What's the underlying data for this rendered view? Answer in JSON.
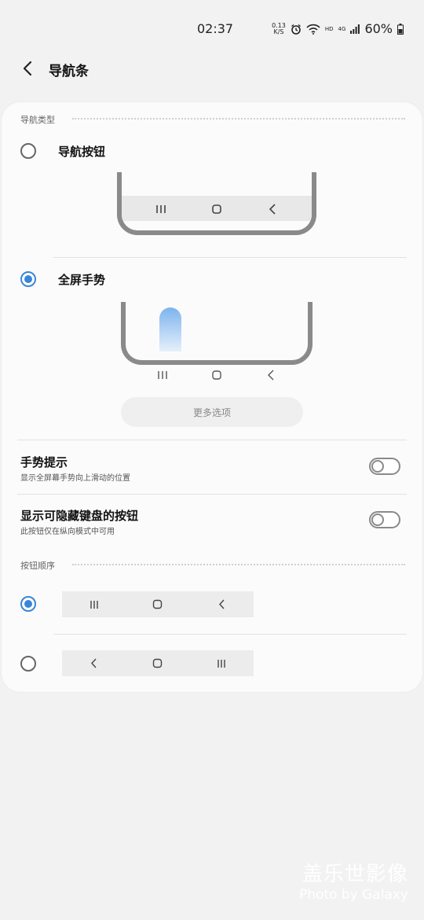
{
  "status": {
    "time": "02:37",
    "speed_top": "0.13",
    "speed_bottom": "K/S",
    "hd": "HD",
    "net": "4G",
    "battery": "60%"
  },
  "header": {
    "title": "导航条",
    "back_icon": "chevron-left-icon"
  },
  "nav_type": {
    "section_label": "导航类型",
    "options": [
      {
        "label": "导航按钮",
        "selected": false
      },
      {
        "label": "全屏手势",
        "selected": true
      }
    ],
    "more_options": "更多选项"
  },
  "settings": {
    "gesture_hint": {
      "title": "手势提示",
      "subtitle": "显示全屏幕手势向上滑动的位置",
      "enabled": false
    },
    "hide_keyboard": {
      "title": "显示可隐藏键盘的按钮",
      "subtitle": "此按钮仅在纵向模式中可用",
      "enabled": false
    }
  },
  "button_order": {
    "section_label": "按钮顺序",
    "options": [
      {
        "selected": true,
        "icons": [
          "recents-icon",
          "home-icon",
          "back-icon"
        ]
      },
      {
        "selected": false,
        "icons": [
          "back-icon",
          "home-icon",
          "recents-icon"
        ]
      }
    ]
  },
  "watermark": {
    "line1": "盖乐世影像",
    "line2": "Photo by Galaxy"
  },
  "colors": {
    "accent": "#3a86d6",
    "background": "#f2f2f2",
    "card": "#fbfbfb"
  }
}
